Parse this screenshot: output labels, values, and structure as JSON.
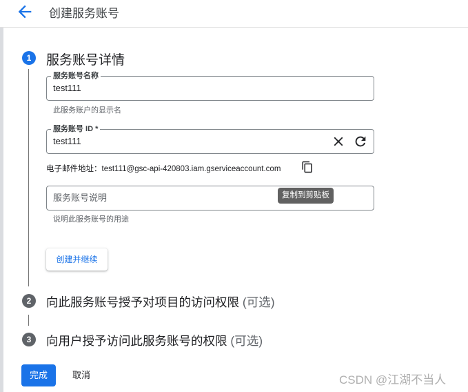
{
  "header": {
    "title": "创建服务账号",
    "back_icon": "arrow-back-icon"
  },
  "steps": [
    {
      "number": "1",
      "title": "服务账号详情"
    },
    {
      "number": "2",
      "title": "向此服务账号授予对项目的访问权限",
      "optional": "(可选)"
    },
    {
      "number": "3",
      "title": "向用户授予访问此服务账号的权限",
      "optional": "(可选)"
    }
  ],
  "form": {
    "name": {
      "label": "服务账号名称",
      "value": "test111",
      "hint": "此服务账户的显示名"
    },
    "id": {
      "label": "服务账号 ID *",
      "value": "test111"
    },
    "email": {
      "label": "电子邮件地址：",
      "value": "test111@gsc-api-420803.iam.gserviceaccount.com"
    },
    "description": {
      "placeholder": "服务账号说明",
      "hint": "说明此服务账号的用途"
    },
    "copy_tooltip": "复制到剪贴板"
  },
  "buttons": {
    "create_continue": "创建并继续",
    "done": "完成",
    "cancel": "取消"
  },
  "watermark": "CSDN @江湖不当人",
  "colors": {
    "accent": "#1a73e8",
    "step_inactive": "#5f6368",
    "tooltip": "#616161"
  }
}
